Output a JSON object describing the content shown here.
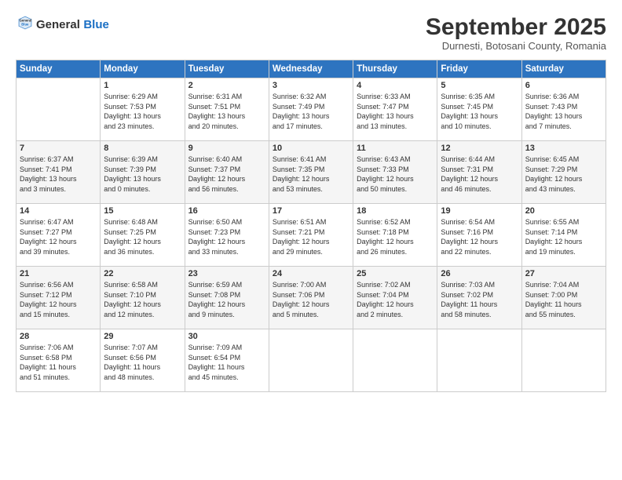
{
  "header": {
    "logo_general": "General",
    "logo_blue": "Blue",
    "month": "September 2025",
    "location": "Durnesti, Botosani County, Romania"
  },
  "days_of_week": [
    "Sunday",
    "Monday",
    "Tuesday",
    "Wednesday",
    "Thursday",
    "Friday",
    "Saturday"
  ],
  "weeks": [
    [
      {
        "date": "",
        "info": ""
      },
      {
        "date": "1",
        "info": "Sunrise: 6:29 AM\nSunset: 7:53 PM\nDaylight: 13 hours\nand 23 minutes."
      },
      {
        "date": "2",
        "info": "Sunrise: 6:31 AM\nSunset: 7:51 PM\nDaylight: 13 hours\nand 20 minutes."
      },
      {
        "date": "3",
        "info": "Sunrise: 6:32 AM\nSunset: 7:49 PM\nDaylight: 13 hours\nand 17 minutes."
      },
      {
        "date": "4",
        "info": "Sunrise: 6:33 AM\nSunset: 7:47 PM\nDaylight: 13 hours\nand 13 minutes."
      },
      {
        "date": "5",
        "info": "Sunrise: 6:35 AM\nSunset: 7:45 PM\nDaylight: 13 hours\nand 10 minutes."
      },
      {
        "date": "6",
        "info": "Sunrise: 6:36 AM\nSunset: 7:43 PM\nDaylight: 13 hours\nand 7 minutes."
      }
    ],
    [
      {
        "date": "7",
        "info": "Sunrise: 6:37 AM\nSunset: 7:41 PM\nDaylight: 13 hours\nand 3 minutes."
      },
      {
        "date": "8",
        "info": "Sunrise: 6:39 AM\nSunset: 7:39 PM\nDaylight: 13 hours\nand 0 minutes."
      },
      {
        "date": "9",
        "info": "Sunrise: 6:40 AM\nSunset: 7:37 PM\nDaylight: 12 hours\nand 56 minutes."
      },
      {
        "date": "10",
        "info": "Sunrise: 6:41 AM\nSunset: 7:35 PM\nDaylight: 12 hours\nand 53 minutes."
      },
      {
        "date": "11",
        "info": "Sunrise: 6:43 AM\nSunset: 7:33 PM\nDaylight: 12 hours\nand 50 minutes."
      },
      {
        "date": "12",
        "info": "Sunrise: 6:44 AM\nSunset: 7:31 PM\nDaylight: 12 hours\nand 46 minutes."
      },
      {
        "date": "13",
        "info": "Sunrise: 6:45 AM\nSunset: 7:29 PM\nDaylight: 12 hours\nand 43 minutes."
      }
    ],
    [
      {
        "date": "14",
        "info": "Sunrise: 6:47 AM\nSunset: 7:27 PM\nDaylight: 12 hours\nand 39 minutes."
      },
      {
        "date": "15",
        "info": "Sunrise: 6:48 AM\nSunset: 7:25 PM\nDaylight: 12 hours\nand 36 minutes."
      },
      {
        "date": "16",
        "info": "Sunrise: 6:50 AM\nSunset: 7:23 PM\nDaylight: 12 hours\nand 33 minutes."
      },
      {
        "date": "17",
        "info": "Sunrise: 6:51 AM\nSunset: 7:21 PM\nDaylight: 12 hours\nand 29 minutes."
      },
      {
        "date": "18",
        "info": "Sunrise: 6:52 AM\nSunset: 7:18 PM\nDaylight: 12 hours\nand 26 minutes."
      },
      {
        "date": "19",
        "info": "Sunrise: 6:54 AM\nSunset: 7:16 PM\nDaylight: 12 hours\nand 22 minutes."
      },
      {
        "date": "20",
        "info": "Sunrise: 6:55 AM\nSunset: 7:14 PM\nDaylight: 12 hours\nand 19 minutes."
      }
    ],
    [
      {
        "date": "21",
        "info": "Sunrise: 6:56 AM\nSunset: 7:12 PM\nDaylight: 12 hours\nand 15 minutes."
      },
      {
        "date": "22",
        "info": "Sunrise: 6:58 AM\nSunset: 7:10 PM\nDaylight: 12 hours\nand 12 minutes."
      },
      {
        "date": "23",
        "info": "Sunrise: 6:59 AM\nSunset: 7:08 PM\nDaylight: 12 hours\nand 9 minutes."
      },
      {
        "date": "24",
        "info": "Sunrise: 7:00 AM\nSunset: 7:06 PM\nDaylight: 12 hours\nand 5 minutes."
      },
      {
        "date": "25",
        "info": "Sunrise: 7:02 AM\nSunset: 7:04 PM\nDaylight: 12 hours\nand 2 minutes."
      },
      {
        "date": "26",
        "info": "Sunrise: 7:03 AM\nSunset: 7:02 PM\nDaylight: 11 hours\nand 58 minutes."
      },
      {
        "date": "27",
        "info": "Sunrise: 7:04 AM\nSunset: 7:00 PM\nDaylight: 11 hours\nand 55 minutes."
      }
    ],
    [
      {
        "date": "28",
        "info": "Sunrise: 7:06 AM\nSunset: 6:58 PM\nDaylight: 11 hours\nand 51 minutes."
      },
      {
        "date": "29",
        "info": "Sunrise: 7:07 AM\nSunset: 6:56 PM\nDaylight: 11 hours\nand 48 minutes."
      },
      {
        "date": "30",
        "info": "Sunrise: 7:09 AM\nSunset: 6:54 PM\nDaylight: 11 hours\nand 45 minutes."
      },
      {
        "date": "",
        "info": ""
      },
      {
        "date": "",
        "info": ""
      },
      {
        "date": "",
        "info": ""
      },
      {
        "date": "",
        "info": ""
      }
    ]
  ]
}
